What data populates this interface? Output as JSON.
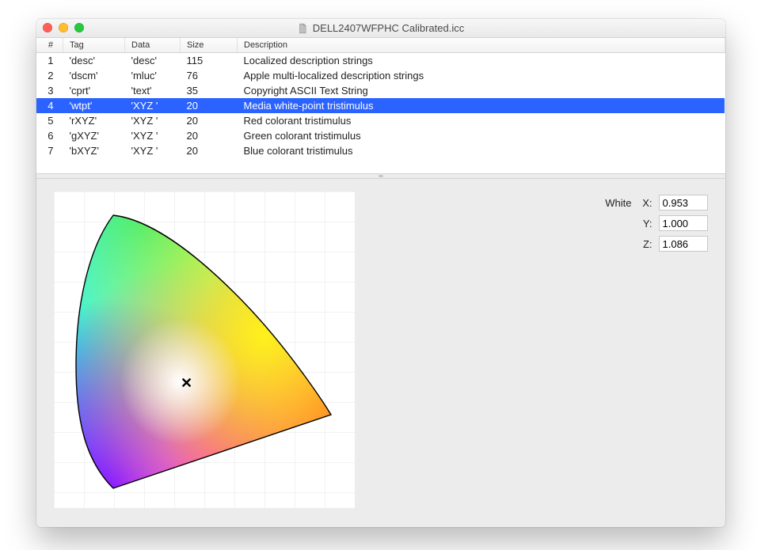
{
  "window": {
    "title": "DELL2407WFPHC Calibrated.icc"
  },
  "columns": {
    "num": "#",
    "tag": "Tag",
    "data": "Data",
    "size": "Size",
    "description": "Description"
  },
  "rows": [
    {
      "num": "1",
      "tag": "'desc'",
      "data_type": "'desc'",
      "size": "115",
      "description": "Localized description strings",
      "selected": false
    },
    {
      "num": "2",
      "tag": "'dscm'",
      "data_type": "'mluc'",
      "size": "76",
      "description": "Apple multi-localized description strings",
      "selected": false
    },
    {
      "num": "3",
      "tag": "'cprt'",
      "data_type": "'text'",
      "size": "35",
      "description": "Copyright ASCII Text String",
      "selected": false
    },
    {
      "num": "4",
      "tag": "'wtpt'",
      "data_type": "'XYZ '",
      "size": "20",
      "description": "Media white-point tristimulus",
      "selected": true
    },
    {
      "num": "5",
      "tag": "'rXYZ'",
      "data_type": "'XYZ '",
      "size": "20",
      "description": "Red colorant tristimulus",
      "selected": false
    },
    {
      "num": "6",
      "tag": "'gXYZ'",
      "data_type": "'XYZ '",
      "size": "20",
      "description": "Green colorant tristimulus",
      "selected": false
    },
    {
      "num": "7",
      "tag": "'bXYZ'",
      "data_type": "'XYZ '",
      "size": "20",
      "description": "Blue colorant tristimulus",
      "selected": false
    }
  ],
  "detail": {
    "label": "White",
    "x_label": "X:",
    "y_label": "Y:",
    "z_label": "Z:",
    "x": "0.953",
    "y": "1.000",
    "z": "1.086",
    "marker": "✕"
  }
}
